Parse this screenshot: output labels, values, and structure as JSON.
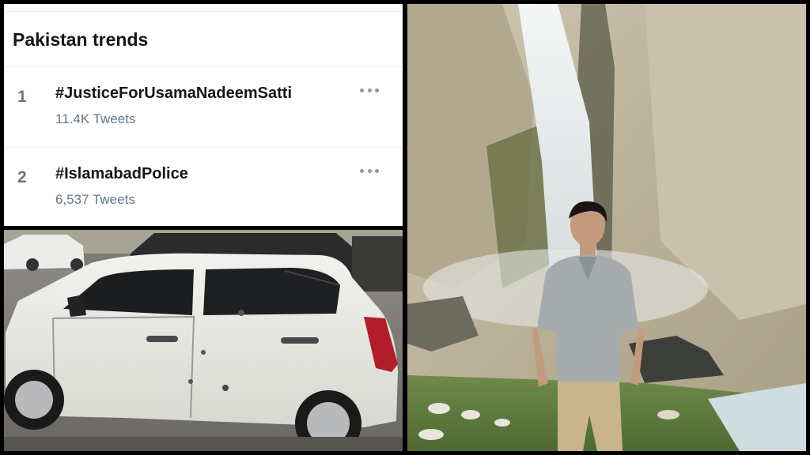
{
  "trends": {
    "title": "Pakistan trends",
    "items": [
      {
        "rank": "1",
        "name": "#JusticeForUsamaNadeemSatti",
        "count": "11.4K Tweets"
      },
      {
        "rank": "2",
        "name": "#IslamabadPolice",
        "count": "6,537 Tweets"
      }
    ]
  },
  "icons": {
    "more": "more-horizontal-icon"
  },
  "colors": {
    "primary_text": "#14171a",
    "secondary_text": "#657786",
    "icon_gray": "#8899a6",
    "divider": "#e6ecf0"
  }
}
